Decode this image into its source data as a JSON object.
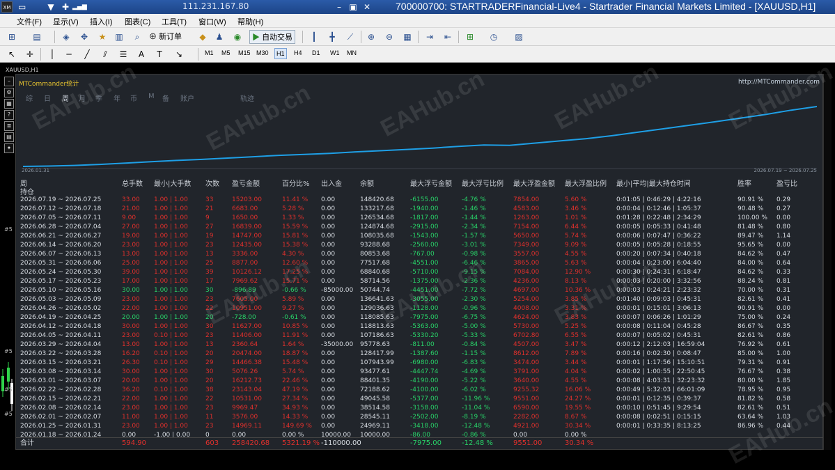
{
  "window": {
    "logo": "XM",
    "ip": "111.231.167.80",
    "title": "700000700: STARTRADERFinancial-Live4 - Startrader Financial Markets Limited - [XAUUSD,H1]"
  },
  "menu": [
    "文件(F)",
    "显示(V)",
    "插入(I)",
    "图表(C)",
    "工具(T)",
    "窗口(W)",
    "帮助(H)"
  ],
  "toolbar": {
    "new_order": "新订单",
    "auto_trade": "自动交易",
    "timeframes": [
      "M1",
      "M5",
      "M15",
      "M30",
      "H1",
      "H4",
      "D1",
      "W1",
      "MN"
    ],
    "active_tf": "H1"
  },
  "chart": {
    "label": "XAUUSD,H1",
    "y_labels": [
      "#5",
      "#5",
      "#5",
      "#5"
    ]
  },
  "panel": {
    "title": "MTCommander统计",
    "url": "http://MTCommander.com",
    "tabs": [
      "综",
      "日",
      "周",
      "月",
      "季",
      "年",
      "币",
      "M",
      "备",
      "账户",
      "",
      "轨迹"
    ],
    "active_tab": "周",
    "equity": {
      "start_label": "2026.01.31",
      "end_label": "2026.07.19 ~ 2026.07.25",
      "values": [
        10000,
        10400,
        11200,
        12500,
        14100,
        15800,
        17300,
        18600,
        20200,
        21800,
        23500,
        24700,
        26000,
        27800,
        29200,
        30800,
        32400,
        34500,
        36100,
        35800,
        38500,
        41200,
        44000,
        47500,
        51800,
        56000,
        60200,
        64500,
        69000,
        73500,
        78800,
        83200
      ]
    },
    "headers": {
      "period": "周",
      "holding": "持仓",
      "trades": "总手数",
      "minmax": "最小|大手数",
      "count": "次数",
      "pnl": "盈亏金额",
      "pct": "百分比%",
      "deposit": "出入金",
      "balance": "余额",
      "max_float_loss": "最大浮亏金额",
      "max_float_loss_pct": "最大浮亏比例",
      "max_float_profit": "最大浮盈金额",
      "max_float_profit_pct": "最大浮盈比例",
      "hold_time": "最小|平均|最大持仓时间",
      "winrate": "胜率",
      "pl_ratio": "盈亏比"
    },
    "rows": [
      [
        "2026.07.19 ~ 2026.07.25",
        "33.00",
        "1.00 | 1.00",
        "33",
        "15203.00",
        "11.41 %",
        "0.00",
        "148420.68",
        "-6155.00",
        "-4.76 %",
        "7854.00",
        "5.60 %",
        "0:01:05 | 0:46:29 | 4:22:16",
        "90.91 %",
        "0.29",
        "r"
      ],
      [
        "2026.07.12 ~ 2026.07.18",
        "21.00",
        "1.00 | 1.00",
        "21",
        "6683.00",
        "5.28 %",
        "0.00",
        "133217.68",
        "-1940.00",
        "-1.46 %",
        "4583.00",
        "3.46 %",
        "0:00:04 | 0:12:46 | 1:05:37",
        "90.48 %",
        "0.27",
        "r"
      ],
      [
        "2026.07.05 ~ 2026.07.11",
        "9.00",
        "1.00 | 1.00",
        "9",
        "1650.00",
        "1.33 %",
        "0.00",
        "126534.68",
        "-1817.00",
        "-1.44 %",
        "1263.00",
        "1.01 %",
        "0:01:28 | 0:22:48 | 2:34:29",
        "100.00 %",
        "0.00",
        "r"
      ],
      [
        "2026.06.28 ~ 2026.07.04",
        "27.00",
        "1.00 | 1.00",
        "27",
        "16839.00",
        "15.59 %",
        "0.00",
        "124874.68",
        "-2915.00",
        "-2.34 %",
        "7154.00",
        "6.44 %",
        "0:00:05 | 0:05:33 | 0:41:48",
        "81.48 %",
        "0.80",
        "r"
      ],
      [
        "2026.06.21 ~ 2026.06.27",
        "19.00",
        "1.00 | 1.00",
        "19",
        "14747.00",
        "15.81 %",
        "0.00",
        "108035.68",
        "-1543.00",
        "-1.57 %",
        "5650.00",
        "5.74 %",
        "0:00:06 | 0:07:47 | 0:36:22",
        "89.47 %",
        "1.14",
        "r"
      ],
      [
        "2026.06.14 ~ 2026.06.20",
        "23.00",
        "1.00 | 1.00",
        "23",
        "12435.00",
        "15.38 %",
        "0.00",
        "93288.68",
        "-2560.00",
        "-3.01 %",
        "7349.00",
        "9.09 %",
        "0:00:05 | 0:05:28 | 0:18:55",
        "95.65 %",
        "0.00",
        "r"
      ],
      [
        "2026.06.07 ~ 2026.06.13",
        "13.00",
        "1.00 | 1.00",
        "13",
        "3336.00",
        "4.30 %",
        "0.00",
        "80853.68",
        "-767.00",
        "-0.98 %",
        "3557.00",
        "4.55 %",
        "0:00:20 | 0:07:34 | 0:40:18",
        "84.62 %",
        "0.47",
        "r"
      ],
      [
        "2026.05.31 ~ 2026.06.06",
        "25.00",
        "1.00 | 1.00",
        "25",
        "8877.00",
        "12.60 %",
        "0.00",
        "77517.68",
        "-4551.00",
        "-6.46 %",
        "3865.00",
        "5.63 %",
        "0:00:04 | 0:23:00 | 6:04:40",
        "84.00 %",
        "0.64",
        "r"
      ],
      [
        "2026.05.24 ~ 2026.05.30",
        "39.00",
        "1.00 | 1.00",
        "39",
        "10126.12",
        "17.25 %",
        "0.00",
        "68840.68",
        "-5710.00",
        "-9.15 %",
        "7084.00",
        "12.90 %",
        "0:00:30 | 0:24:31 | 6:18:47",
        "84.62 %",
        "0.33",
        "r"
      ],
      [
        "2026.05.17 ~ 2026.05.23",
        "17.00",
        "1.00 | 1.00",
        "17",
        "7969.62",
        "15.71 %",
        "0.00",
        "58714.56",
        "-1375.00",
        "-2.36 %",
        "4236.00",
        "8.13 %",
        "0:00:03 | 0:20:00 | 3:32:56",
        "88.24 %",
        "0.81",
        "r"
      ],
      [
        "2026.05.10 ~ 2026.05.16",
        "30.00",
        "1.00 | 1.00",
        "30",
        "-896.89",
        "-0.66 %",
        "-85000.00",
        "50744.74",
        "-4451.00",
        "-7.72 %",
        "4697.00",
        "10.36 %",
        "0:00:03 | 0:24:21 | 2:23:32",
        "70.00 %",
        "0.31",
        "g"
      ],
      [
        "2026.05.03 ~ 2026.05.09",
        "23.00",
        "1.00 | 1.00",
        "23",
        "7605.00",
        "5.89 %",
        "0.00",
        "136641.63",
        "-3055.00",
        "-2.30 %",
        "5254.00",
        "3.85 %",
        "0:01:40 | 0:09:03 | 0:45:31",
        "82.61 %",
        "0.41",
        "r"
      ],
      [
        "2026.04.26 ~ 2026.05.02",
        "22.00",
        "1.00 | 1.00",
        "22",
        "10951.00",
        "9.27 %",
        "0.00",
        "129036.63",
        "-1128.00",
        "-0.96 %",
        "4008.00",
        "3.31 %",
        "0:00:01 | 0:15:01 | 3:06:13",
        "90.91 %",
        "0.00",
        "r"
      ],
      [
        "2026.04.19 ~ 2026.04.25",
        "20.00",
        "1.00 | 1.00",
        "20",
        "-728.00",
        "-0.61 %",
        "0.00",
        "118085.63",
        "-7975.00",
        "-6.75 %",
        "4624.00",
        "3.83 %",
        "0:00:07 | 0:06:26 | 1:01:29",
        "75.00 %",
        "0.24",
        "g"
      ],
      [
        "2026.04.12 ~ 2026.04.18",
        "30.00",
        "1.00 | 1.00",
        "30",
        "11627.00",
        "10.85 %",
        "0.00",
        "118813.63",
        "-5363.00",
        "-5.00 %",
        "5730.00",
        "5.25 %",
        "0:00:08 | 0:11:04 | 0:45:28",
        "86.67 %",
        "0.35",
        "r"
      ],
      [
        "2026.04.05 ~ 2026.04.11",
        "23.00",
        "0.10 | 1.00",
        "23",
        "11406.00",
        "11.91 %",
        "0.00",
        "107186.63",
        "-5330.20",
        "-5.33 %",
        "6702.80",
        "6.55 %",
        "0:00:07 | 0:05:02 | 0:45:31",
        "82.61 %",
        "0.86",
        "r"
      ],
      [
        "2026.03.29 ~ 2026.04.04",
        "13.00",
        "1.00 | 1.00",
        "13",
        "2360.64",
        "1.64 %",
        "-35000.00",
        "95778.63",
        "-811.00",
        "-0.84 %",
        "4507.00",
        "3.47 %",
        "0:00:12 | 2:12:03 | 16:59:04",
        "76.92 %",
        "0.61",
        "r"
      ],
      [
        "2026.03.22 ~ 2026.03.28",
        "16.20",
        "0.10 | 1.00",
        "20",
        "20474.00",
        "18.87 %",
        "0.00",
        "128417.99",
        "-1387.60",
        "-1.15 %",
        "8612.00",
        "7.89 %",
        "0:00:16 | 0:02:30 | 0:08:47",
        "85.00 %",
        "1.00",
        "r"
      ],
      [
        "2026.03.15 ~ 2026.03.21",
        "26.30",
        "0.10 | 1.00",
        "29",
        "14466.38",
        "15.48 %",
        "0.00",
        "107943.99",
        "-6980.00",
        "-6.83 %",
        "3474.00",
        "3.44 %",
        "0:00:01 | 1:17:56 | 15:10:51",
        "79.31 %",
        "0.91",
        "r"
      ],
      [
        "2026.03.08 ~ 2026.03.14",
        "30.00",
        "1.00 | 1.00",
        "30",
        "5076.26",
        "5.74 %",
        "0.00",
        "93477.61",
        "-4447.74",
        "-4.69 %",
        "3791.00",
        "4.04 %",
        "0:00:02 | 1:00:55 | 22:50:45",
        "76.67 %",
        "0.38",
        "r"
      ],
      [
        "2026.03.01 ~ 2026.03.07",
        "20.00",
        "1.00 | 1.00",
        "20",
        "16212.73",
        "22.46 %",
        "0.00",
        "88401.35",
        "-4190.00",
        "-5.22 %",
        "3640.00",
        "4.55 %",
        "0:00:08 | 4:03:31 | 32:23:32",
        "80.00 %",
        "1.85",
        "r"
      ],
      [
        "2026.02.22 ~ 2026.02.28",
        "36.20",
        "0.10 | 1.00",
        "38",
        "23143.04",
        "47.19 %",
        "0.00",
        "72188.62",
        "-4100.00",
        "-6.02 %",
        "9255.32",
        "16.06 %",
        "0:00:49 | 5:32:03 | 66:01:09",
        "78.95 %",
        "0.95",
        "r"
      ],
      [
        "2026.02.15 ~ 2026.02.21",
        "22.00",
        "1.00 | 1.00",
        "22",
        "10531.00",
        "27.34 %",
        "0.00",
        "49045.58",
        "-5377.00",
        "-11.96 %",
        "9551.00",
        "24.27 %",
        "0:00:01 | 0:12:35 | 0:39:37",
        "81.82 %",
        "0.58",
        "r"
      ],
      [
        "2026.02.08 ~ 2026.02.14",
        "23.00",
        "1.00 | 1.00",
        "23",
        "9969.47",
        "34.93 %",
        "0.00",
        "38514.58",
        "-3158.00",
        "-11.04 %",
        "6590.00",
        "19.55 %",
        "0:00:10 | 0:51:45 | 9:29:54",
        "82.61 %",
        "0.51",
        "r"
      ],
      [
        "2026.02.01 ~ 2026.02.07",
        "11.00",
        "1.00 | 1.00",
        "11",
        "3576.00",
        "14.33 %",
        "0.00",
        "28545.11",
        "-2502.00",
        "-8.19 %",
        "2282.00",
        "8.67 %",
        "0:00:08 | 0:02:51 | 0:15:15",
        "63.64 %",
        "1.03",
        "r"
      ],
      [
        "2026.01.25 ~ 2026.01.31",
        "23.00",
        "1.00 | 1.00",
        "23",
        "14969.11",
        "149.69 %",
        "0.00",
        "24969.11",
        "-3418.00",
        "-12.48 %",
        "4921.00",
        "30.34 %",
        "0:00:01 | 0:33:35 | 8:13:25",
        "86.96 %",
        "0.44",
        "r"
      ],
      [
        "2026.01.18 ~ 2026.01.24",
        "0.00",
        "-1.00 | 0.00",
        "0",
        "0.00",
        "0.00 %",
        "10000.00",
        "10000.00",
        "-86.00",
        "-0.86 %",
        "0.00",
        "0.00 %",
        "",
        "",
        "",
        "z"
      ]
    ],
    "sum": {
      "label": "合计",
      "trades": "594.90",
      "count": "603",
      "pnl": "258420.68",
      "pct": "5321.19 %",
      "deposit": "-110000.00",
      "max_float_loss": "-7975.00",
      "max_float_loss_pct": "-12.48 %",
      "max_float_profit": "9551.00",
      "max_float_profit_pct": "30.34 %"
    }
  },
  "watermark": "EAHub.cn"
}
